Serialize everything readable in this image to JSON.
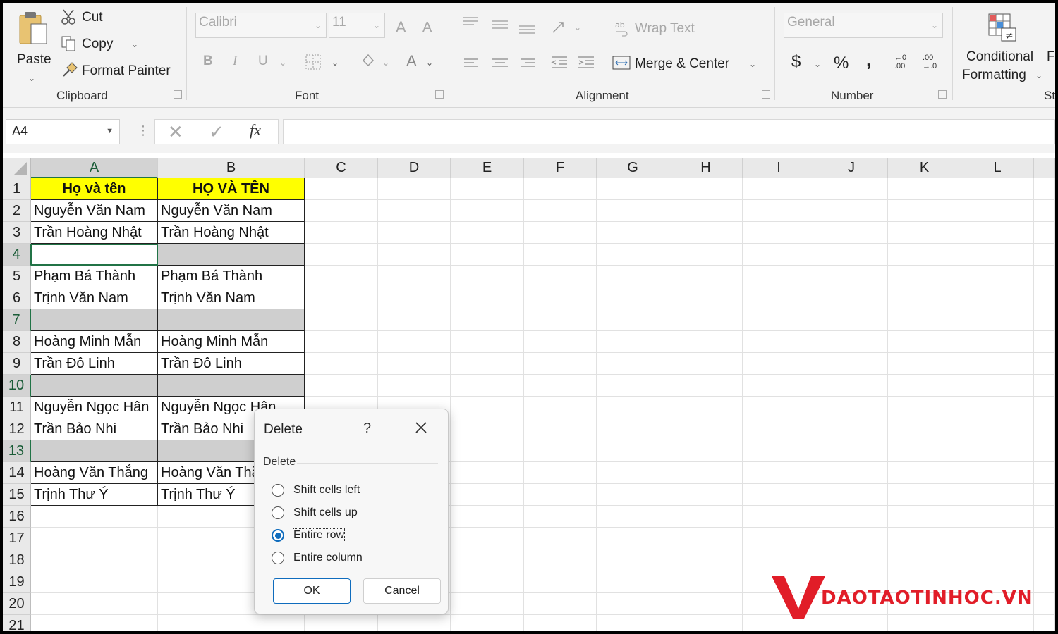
{
  "ribbon": {
    "clipboard": {
      "paste": "Paste",
      "cut": "Cut",
      "copy": "Copy",
      "format_painter": "Format Painter",
      "label": "Clipboard"
    },
    "font": {
      "name": "Calibri",
      "size": "11",
      "grow": "A",
      "shrink": "A",
      "bold": "B",
      "italic": "I",
      "underline": "U",
      "font_color": "A",
      "label": "Font"
    },
    "alignment": {
      "wrap_text": "Wrap Text",
      "merge_center": "Merge & Center",
      "label": "Alignment"
    },
    "number": {
      "format": "General",
      "currency": "$",
      "percent": "%",
      "comma": ",",
      "inc_dec_top": "←0",
      "inc_dec_bot": ".00",
      "dec_dec_top": ".00",
      "dec_dec_bot": "→.0",
      "label": "Number"
    },
    "styles": {
      "conditional_line1": "Conditional",
      "conditional_line2": "Formatting",
      "partial_next": "F",
      "partial_label": "St"
    }
  },
  "formula_bar": {
    "name_box": "A4",
    "fx": "fx",
    "value": ""
  },
  "grid": {
    "columns": [
      "A",
      "B",
      "C",
      "D",
      "E",
      "F",
      "G",
      "H",
      "I",
      "J",
      "K",
      "L"
    ],
    "rows": [
      "1",
      "2",
      "3",
      "4",
      "5",
      "6",
      "7",
      "8",
      "9",
      "10",
      "11",
      "12",
      "13",
      "14",
      "15",
      "16",
      "17",
      "18",
      "19",
      "20",
      "21"
    ],
    "header": {
      "a": "Họ và tên",
      "b": "HỌ VÀ TÊN"
    },
    "data": [
      {
        "a": "Nguyễn Văn Nam",
        "b": "Nguyễn Văn Nam"
      },
      {
        "a": "Trần Hoàng Nhật",
        "b": "Trần Hoàng Nhật"
      },
      {
        "a": "",
        "b": ""
      },
      {
        "a": "Phạm Bá Thành",
        "b": "Phạm Bá Thành"
      },
      {
        "a": "Trịnh Văn Nam",
        "b": "Trịnh Văn Nam"
      },
      {
        "a": "",
        "b": ""
      },
      {
        "a": "Hoàng Minh Mẫn",
        "b": "Hoàng Minh Mẫn"
      },
      {
        "a": "Trần Đô Linh",
        "b": "Trần Đô Linh"
      },
      {
        "a": "",
        "b": ""
      },
      {
        "a": "Nguyễn Ngọc Hân",
        "b": "Nguyễn Ngọc Hân"
      },
      {
        "a": "Trần Bảo Nhi",
        "b": "Trần Bảo Nhi"
      },
      {
        "a": "",
        "b": ""
      },
      {
        "a": "Hoàng Văn Thắng",
        "b": "Hoàng Văn Thắng"
      },
      {
        "a": "Trịnh Thư Ý",
        "b": "Trịnh Thư Ý"
      }
    ]
  },
  "dialog": {
    "title": "Delete",
    "help": "?",
    "group": "Delete",
    "options": [
      {
        "label": "Shift cells left",
        "selected": false
      },
      {
        "label": "Shift cells up",
        "selected": false
      },
      {
        "label": "Entire row",
        "selected": true
      },
      {
        "label": "Entire column",
        "selected": false
      }
    ],
    "ok": "OK",
    "cancel": "Cancel"
  },
  "watermark": {
    "text": "DAOTAOTINHOC.VN"
  },
  "colors": {
    "excel_green": "#217346",
    "highlight_yellow": "#ffff00",
    "blank_row_gray": "#cfcfcf",
    "focus_blue": "#0f6cbd",
    "logo_red": "#e11d28"
  }
}
